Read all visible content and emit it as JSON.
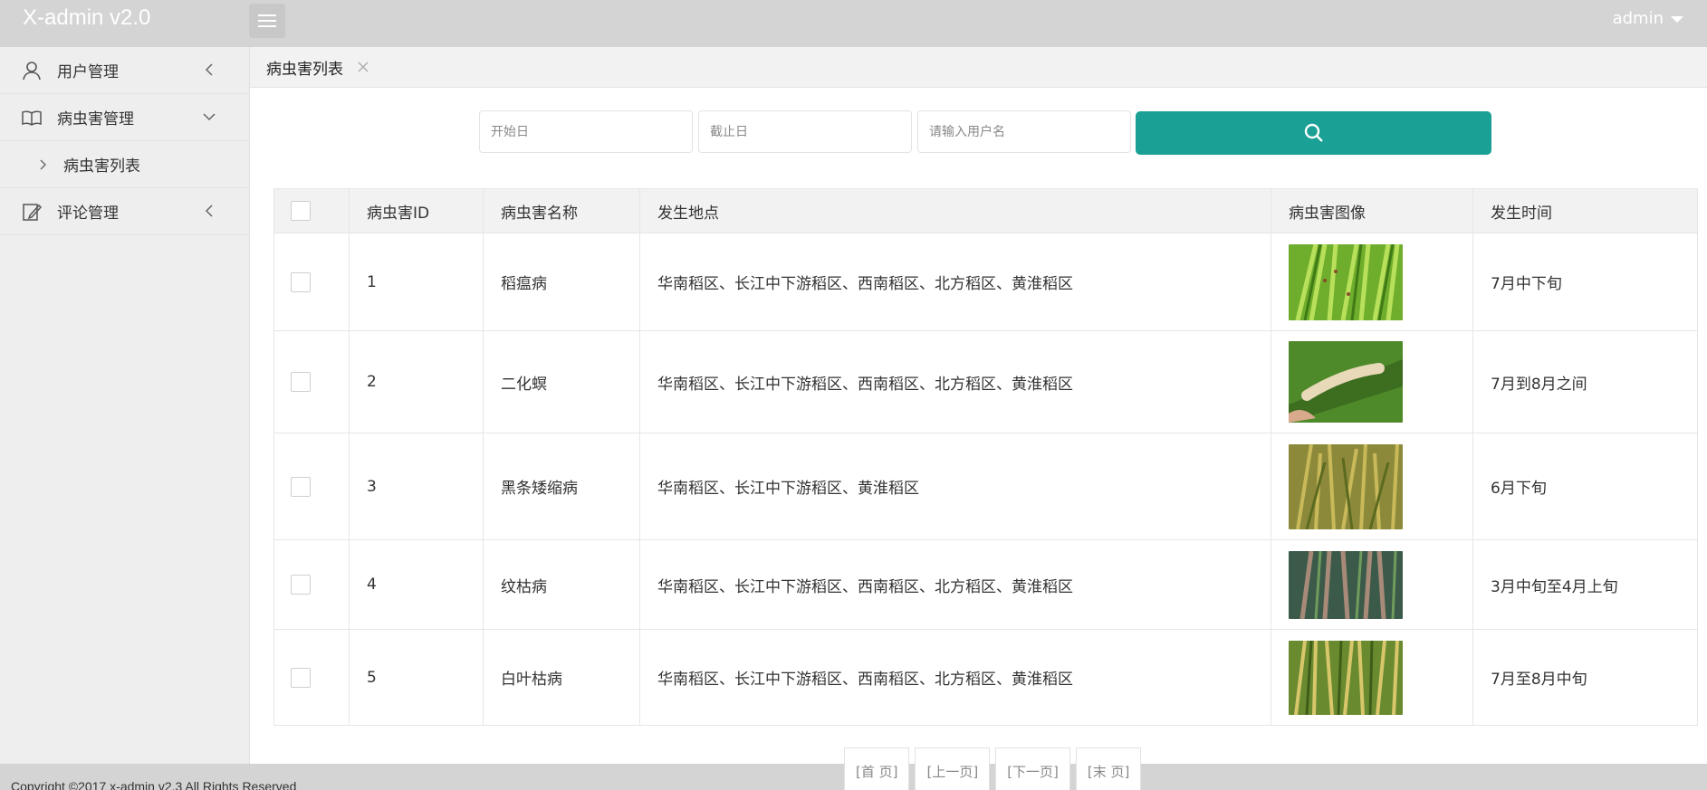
{
  "header": {
    "logo": "X-admin v2.0",
    "user": "admin"
  },
  "sidebar": {
    "items": [
      {
        "label": "用户管理",
        "icon": "user-icon"
      },
      {
        "label": "病虫害管理",
        "icon": "book-icon",
        "expanded": true,
        "children": [
          {
            "label": "病虫害列表"
          }
        ]
      },
      {
        "label": "评论管理",
        "icon": "edit-icon"
      }
    ]
  },
  "tabs": [
    {
      "label": "病虫害列表",
      "active": true
    }
  ],
  "search": {
    "start_placeholder": "开始日",
    "end_placeholder": "截止日",
    "username_placeholder": "请输入用户名",
    "button_color": "#1aa094"
  },
  "table": {
    "headers": [
      "病虫害ID",
      "病虫害名称",
      "发生地点",
      "病虫害图像",
      "发生时间"
    ],
    "rows": [
      {
        "id": "1",
        "name": "稻瘟病",
        "location": "华南稻区、长江中下游稻区、西南稻区、北方稻区、黄淮稻区",
        "time": "7月中下旬",
        "image": "rice-blast-photo"
      },
      {
        "id": "2",
        "name": "二化螟",
        "location": "华南稻区、长江中下游稻区、西南稻区、北方稻区、黄淮稻区",
        "time": "7月到8月之间",
        "image": "stem-borer-photo"
      },
      {
        "id": "3",
        "name": "黑条矮缩病",
        "location": "华南稻区、长江中下游稻区、黄淮稻区",
        "time": "6月下旬",
        "image": "dwarf-disease-photo"
      },
      {
        "id": "4",
        "name": "纹枯病",
        "location": "华南稻区、长江中下游稻区、西南稻区、北方稻区、黄淮稻区",
        "time": "3月中旬至4月上旬",
        "image": "sheath-blight-photo"
      },
      {
        "id": "5",
        "name": "白叶枯病",
        "location": "华南稻区、长江中下游稻区、西南稻区、北方稻区、黄淮稻区",
        "time": "7月至8月中旬",
        "image": "leaf-blight-photo"
      }
    ]
  },
  "pager": {
    "first": "[首 页]",
    "prev": "[上一页]",
    "next": "[下一页]",
    "last": "[末 页]"
  },
  "footer": {
    "copyright": "Copyright ©2017 x-admin v2.3 All Rights Reserved"
  }
}
